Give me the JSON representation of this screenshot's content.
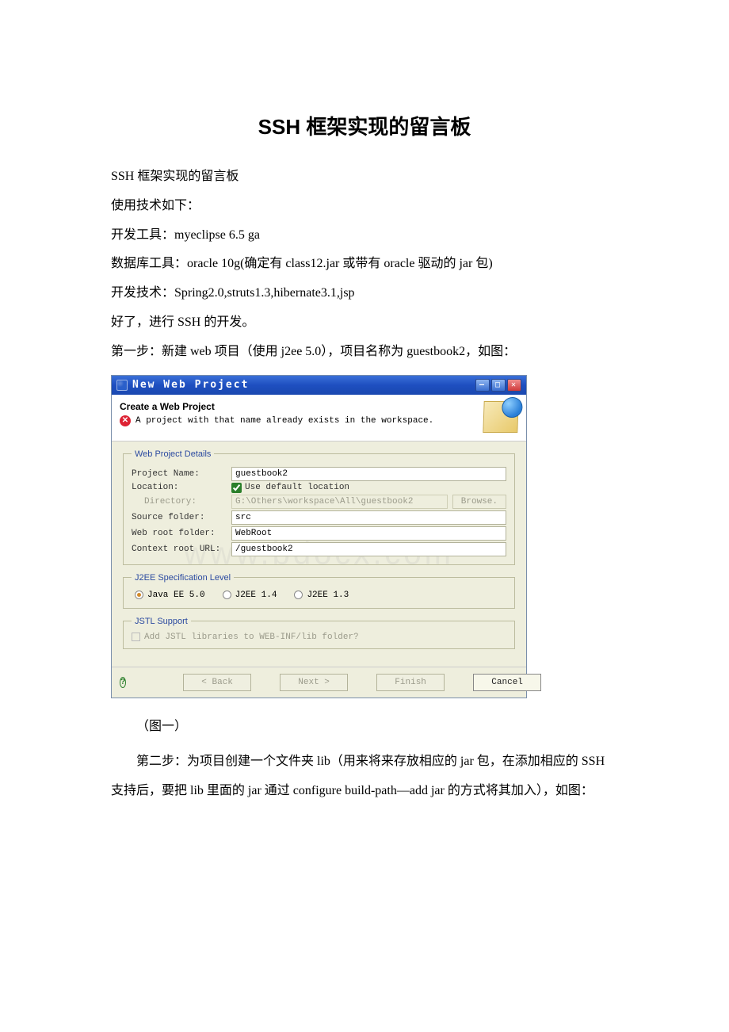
{
  "doc": {
    "title": "SSH 框架实现的留言板",
    "p1": "SSH 框架实现的留言板",
    "p2": "使用技术如下：",
    "p3": "开发工具：myeclipse 6.5 ga",
    "p4": "数据库工具：oracle 10g(确定有 class12.jar 或带有 oracle 驱动的 jar 包)",
    "p5": "开发技术：Spring2.0,struts1.3,hibernate3.1,jsp",
    "p6": "好了，进行 SSH 的开发。",
    "p7": "第一步：新建 web 项目（使用 j2ee 5.0），项目名称为 guestbook2，如图：",
    "fig1": "（图一）",
    "p8": "第二步：为项目创建一个文件夹 lib（用来将来存放相应的 jar 包，在添加相应的 SSH 支持后，要把 lib 里面的 jar 通过 configure build-path—add jar 的方式将其加入），如图："
  },
  "watermark": "www.bdocx.com",
  "dialog": {
    "titlebar": "New Web Project",
    "header_title": "Create a Web Project",
    "header_msg": "A project with that name already exists in the workspace.",
    "group_details": "Web Project Details",
    "labels": {
      "project_name": "Project Name:",
      "location": "Location:",
      "directory": "Directory:",
      "source_folder": "Source folder:",
      "web_root": "Web root folder:",
      "context_root": "Context root URL:",
      "use_default": "Use default location"
    },
    "values": {
      "project_name": "guestbook2",
      "directory": "G:\\Others\\workspace\\All\\guestbook2",
      "source_folder": "src",
      "web_root": "WebRoot",
      "context_root": "/guestbook2"
    },
    "browse": "Browse.",
    "group_j2ee": "J2EE Specification Level",
    "radios": {
      "ee5": "Java EE 5.0",
      "j14": "J2EE 1.4",
      "j13": "J2EE 1.3"
    },
    "group_jstl": "JSTL Support",
    "jstl_label": "Add JSTL libraries to WEB-INF/lib folder?",
    "buttons": {
      "back": "< Back",
      "next": "Next >",
      "finish": "Finish",
      "cancel": "Cancel"
    }
  }
}
